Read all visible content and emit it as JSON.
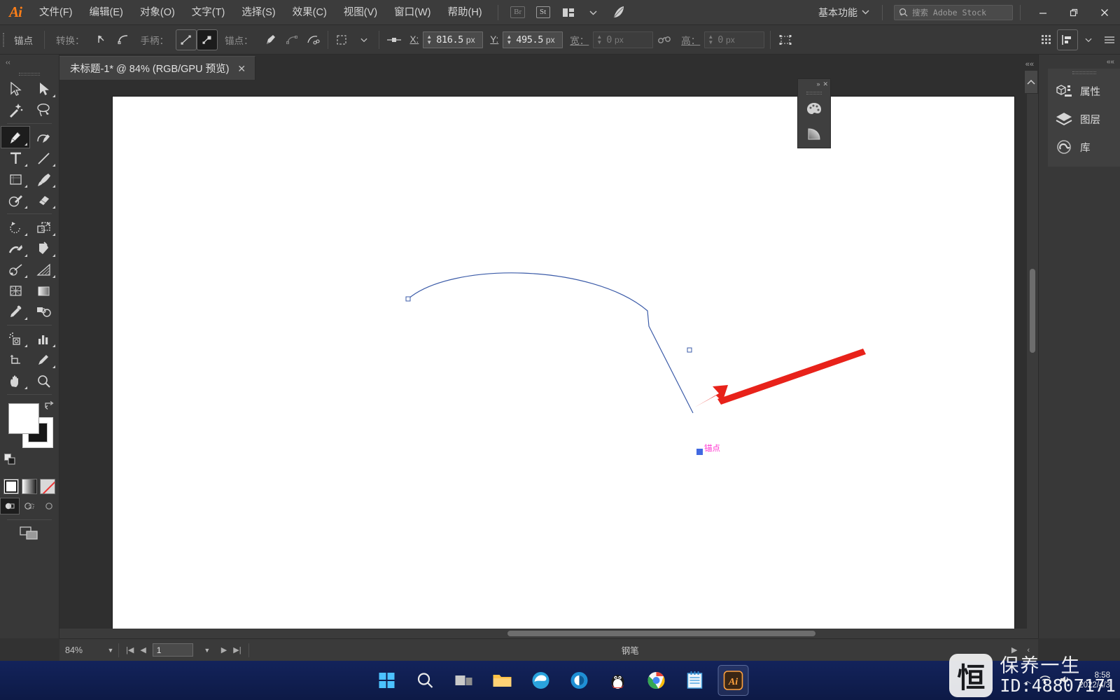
{
  "app": {
    "name": "Adobe Illustrator",
    "logo_text": "Ai"
  },
  "menubar": {
    "items": [
      {
        "label": "文件(F)"
      },
      {
        "label": "编辑(E)"
      },
      {
        "label": "对象(O)"
      },
      {
        "label": "文字(T)"
      },
      {
        "label": "选择(S)"
      },
      {
        "label": "效果(C)"
      },
      {
        "label": "视图(V)"
      },
      {
        "label": "窗口(W)"
      },
      {
        "label": "帮助(H)"
      }
    ],
    "bridge_badge": "Br",
    "stock_badge": "St",
    "workspace": "基本功能",
    "search_placeholder": "搜索 Adobe Stock",
    "window_controls": {
      "minimize": "—",
      "restore": "❐",
      "close": "✕"
    }
  },
  "controlbar": {
    "context_label": "锚点",
    "convert_label": "转换：",
    "handles_label": "手柄：",
    "anchors_label": "锚点：",
    "x_label": "X:",
    "x_value": "816.5",
    "x_unit": "px",
    "y_label": "Y:",
    "y_value": "495.5",
    "y_unit": "px",
    "w_label": "宽：",
    "w_value": "0",
    "w_unit": "px",
    "h_label": "高：",
    "h_value": "0",
    "h_unit": "px"
  },
  "tab": {
    "title": "未标题-1* @ 84% (RGB/GPU 预览)",
    "close": "✕"
  },
  "toolbar": {
    "tools": [
      {
        "name": "selection-tool",
        "selected": false
      },
      {
        "name": "direct-selection-tool",
        "selected": false
      },
      {
        "name": "magic-wand-tool",
        "selected": false
      },
      {
        "name": "lasso-tool",
        "selected": false
      },
      {
        "name": "pen-tool",
        "selected": true
      },
      {
        "name": "curvature-tool",
        "selected": false
      },
      {
        "name": "type-tool",
        "selected": false
      },
      {
        "name": "line-segment-tool",
        "selected": false
      },
      {
        "name": "rectangle-tool",
        "selected": false
      },
      {
        "name": "paintbrush-tool",
        "selected": false
      },
      {
        "name": "shaper-tool",
        "selected": false
      },
      {
        "name": "eraser-tool",
        "selected": false
      },
      {
        "name": "rotate-tool",
        "selected": false
      },
      {
        "name": "scale-tool",
        "selected": false
      },
      {
        "name": "width-tool",
        "selected": false
      },
      {
        "name": "free-transform-tool",
        "selected": false
      },
      {
        "name": "shape-builder-tool",
        "selected": false
      },
      {
        "name": "perspective-grid-tool",
        "selected": false
      },
      {
        "name": "mesh-tool",
        "selected": false
      },
      {
        "name": "gradient-tool",
        "selected": false
      },
      {
        "name": "eyedropper-tool",
        "selected": false
      },
      {
        "name": "blend-tool",
        "selected": false
      },
      {
        "name": "symbol-sprayer-tool",
        "selected": false
      },
      {
        "name": "column-graph-tool",
        "selected": false
      },
      {
        "name": "artboard-tool",
        "selected": false
      },
      {
        "name": "slice-tool",
        "selected": false
      },
      {
        "name": "hand-tool",
        "selected": false
      },
      {
        "name": "zoom-tool",
        "selected": false
      }
    ],
    "fill_color": "#ffffff",
    "stroke_color": "#000000"
  },
  "floating_panel": {
    "buttons": [
      "color-panel-icon",
      "gradient-panel-icon"
    ],
    "collapse": "»",
    "close": "✕"
  },
  "right_dock": {
    "collapse": "««",
    "items": [
      {
        "label": "属性",
        "icon": "properties-icon"
      },
      {
        "label": "图层",
        "icon": "layers-icon"
      },
      {
        "label": "库",
        "icon": "libraries-icon"
      }
    ]
  },
  "canvas": {
    "anchor_label": "锚点",
    "path_stroke_color": "#3b5ba8",
    "selected_anchor_color": "#4169e1",
    "smart_guide_color": "#ff3ad1",
    "annotation_arrow_color": "#e8221a"
  },
  "statusbar": {
    "zoom": "84%",
    "page": "1",
    "tool_name": "钢笔",
    "nav_first": "|◀",
    "nav_prev": "◀",
    "nav_next": "▶",
    "nav_last": "▶|"
  },
  "taskbar": {
    "apps": [
      {
        "name": "start-button"
      },
      {
        "name": "search-button"
      },
      {
        "name": "task-view-button"
      },
      {
        "name": "file-explorer-button"
      },
      {
        "name": "edge-button"
      },
      {
        "name": "cortana-button"
      },
      {
        "name": "qq-button"
      },
      {
        "name": "chrome-button"
      },
      {
        "name": "notepad-button"
      },
      {
        "name": "illustrator-button",
        "active": true
      }
    ],
    "tray": {
      "overflow": "︿",
      "time": "8:58",
      "date": "2022/4/3"
    }
  },
  "watermark": {
    "logo_char": "恒",
    "line1": "保养一生",
    "line2": "ID:48807171"
  }
}
